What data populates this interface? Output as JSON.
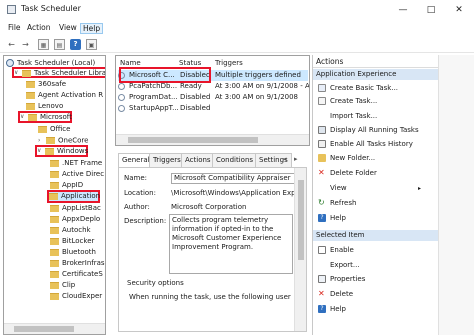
{
  "window": {
    "title": "Task Scheduler"
  },
  "menu": [
    "File",
    "Action",
    "View",
    "Help"
  ],
  "tree": {
    "items": [
      {
        "label": "Task Scheduler (Local)"
      },
      {
        "label": "Task Scheduler Library"
      },
      {
        "label": "360safe"
      },
      {
        "label": "Agent Activation R"
      },
      {
        "label": "Lenovo"
      },
      {
        "label": "Microsoft"
      },
      {
        "label": "Office"
      },
      {
        "label": "OneCore"
      },
      {
        "label": "Windows"
      },
      {
        "label": ".NET Frame"
      },
      {
        "label": "Active Direc"
      },
      {
        "label": "AppID"
      },
      {
        "label": "Application"
      },
      {
        "label": "AppListBac"
      },
      {
        "label": "AppxDeplo"
      },
      {
        "label": "Autochk"
      },
      {
        "label": "BitLocker"
      },
      {
        "label": "Bluetooth"
      },
      {
        "label": "BrokerInfras"
      },
      {
        "label": "CertificateS"
      },
      {
        "label": "Clip"
      },
      {
        "label": "CloudExper"
      }
    ]
  },
  "tasks": {
    "columns": [
      "Name",
      "Status",
      "Triggers"
    ],
    "rows": [
      {
        "name": "Microsoft C...",
        "status": "Disabled",
        "triggers": "Multiple triggers defined"
      },
      {
        "name": "PcaPatchDb...",
        "status": "Ready",
        "triggers": "At 3:00 AM on 9/1/2008 - Afte"
      },
      {
        "name": "ProgramDat...",
        "status": "Disabled",
        "triggers": "At 3:00 AM on 9/1/2008"
      },
      {
        "name": "StartupAppT...",
        "status": "Disabled",
        "triggers": ""
      }
    ]
  },
  "detail": {
    "tabs": [
      "General",
      "Triggers",
      "Actions",
      "Conditions",
      "Settings"
    ],
    "name_label": "Name:",
    "name_value": "Microsoft Compatibility Appraiser",
    "location_label": "Location:",
    "location_value": "\\Microsoft\\Windows\\Application Experie",
    "author_label": "Author:",
    "author_value": "Microsoft Corporation",
    "description_label": "Description:",
    "description_value": "Collects program telemetry information if opted-in to the Microsoft Customer Experience Improvement Program.",
    "security_label": "Security options",
    "security_text": "When running the task, use the following user accou"
  },
  "actions_panel": {
    "header": "Actions",
    "section1": "Application Experience",
    "items1": [
      "Create Basic Task...",
      "Create Task...",
      "Import Task...",
      "Display All Running Tasks",
      "Enable All Tasks History",
      "New Folder...",
      "Delete Folder",
      "View",
      "Refresh",
      "Help"
    ],
    "section2": "Selected Item",
    "items2": [
      "Enable",
      "Export...",
      "Properties",
      "Delete",
      "Help"
    ]
  },
  "colors": {
    "highlight": "#e8142a",
    "section_bg": "#d8e6f5",
    "selected_row": "#cce8ff"
  }
}
